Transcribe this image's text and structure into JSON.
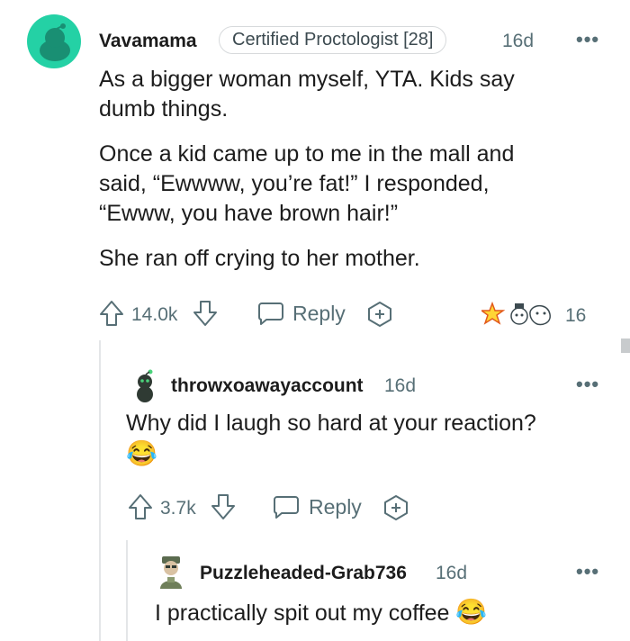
{
  "comments": [
    {
      "username": "Vavamama",
      "flair": "Certified Proctologist [28]",
      "time": "16d",
      "paragraphs": [
        "As a bigger woman myself, YTA. Kids say dumb things.",
        "Once a kid came up to me in the mall and said, “Ewwww, you’re fat!” I responded, “Ewww, you have brown hair!”",
        "She ran off crying to her mother."
      ],
      "score": "14.0k",
      "reply_label": "Reply",
      "awards_count": "16"
    },
    {
      "username": "throwxoawayaccount",
      "time": "16d",
      "text": "Why did I laugh so hard at your reaction?",
      "score": "3.7k",
      "reply_label": "Reply"
    },
    {
      "username": "Puzzleheaded-Grab736",
      "time": "16d",
      "text": "I practically spit out my coffee"
    }
  ],
  "more_options": "•••",
  "emoji_laughing": "😂",
  "colors": {
    "avatar_bg": "#24d1a5",
    "text": "#1c1c1c",
    "meta": "#576f76"
  }
}
